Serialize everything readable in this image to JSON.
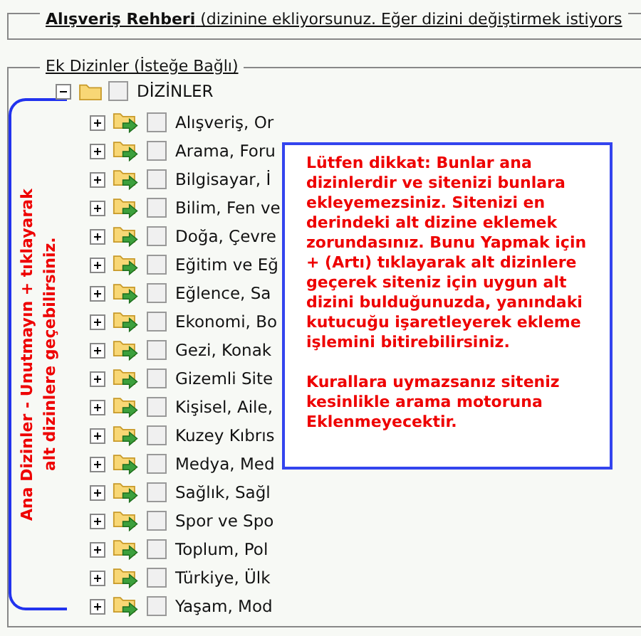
{
  "header": {
    "text": "**Alışveriş Rehberi** (dizinine ekliyorsunuz. Eğer dizini değiştirmek istiyors"
  },
  "section": {
    "legend": "Ek Dizinler (İsteğe Bağlı)"
  },
  "tree": {
    "label": "DİZİNLER",
    "expanded": true,
    "checked": false,
    "children": [
      {
        "label": "Alışveriş, Or",
        "expanded": false,
        "checked": false
      },
      {
        "label": "Arama, Foru",
        "expanded": false,
        "checked": false
      },
      {
        "label": "Bilgisayar, İ",
        "expanded": false,
        "checked": false
      },
      {
        "label": "Bilim, Fen ve",
        "expanded": false,
        "checked": false
      },
      {
        "label": "Doğa, Çevre",
        "expanded": false,
        "checked": false
      },
      {
        "label": "Eğitim ve Eğ",
        "expanded": false,
        "checked": false
      },
      {
        "label": "Eğlence, Sa",
        "expanded": false,
        "checked": false
      },
      {
        "label": "Ekonomi, Bo",
        "expanded": false,
        "checked": false
      },
      {
        "label": "Gezi, Konak",
        "expanded": false,
        "checked": false
      },
      {
        "label": "Gizemli Site",
        "expanded": false,
        "checked": false
      },
      {
        "label": "Kişisel, Aile,",
        "expanded": false,
        "checked": false
      },
      {
        "label": "Kuzey Kıbrıs",
        "expanded": false,
        "checked": false
      },
      {
        "label": "Medya, Med",
        "expanded": false,
        "checked": false
      },
      {
        "label": "Sağlık, Sağl",
        "expanded": false,
        "checked": false
      },
      {
        "label": "Spor ve Spo",
        "expanded": false,
        "checked": false
      },
      {
        "label": "Toplum, Pol",
        "expanded": false,
        "checked": false
      },
      {
        "label": "Türkiye, Ülk",
        "expanded": false,
        "checked": false
      },
      {
        "label": "Yaşam, Mod",
        "expanded": false,
        "checked": false
      }
    ]
  },
  "side_callout": {
    "lines": [
      "Ana Dizinler - Unutmayın + tıklayarak",
      "alt dizinlere geçebilirsiniz."
    ]
  },
  "notice": {
    "paragraphs": [
      "Lütfen dikkat: Bunlar ana dizinlerdir ve sitenizi bunlara ekleyemezsiniz. Sitenizi en derindeki alt dizine eklemek zorundasınız. Bunu Yapmak için + (Artı) tıklayarak alt dizinlere geçerek siteniz için uygun alt dizini bulduğunuzda, yanındaki kutucuğu işaretleyerek ekleme işlemini bitirebilirsiniz.",
      "Kurallara uymazsanız siteniz kesinlikle arama motoruna Eklenmeyecektir."
    ]
  }
}
